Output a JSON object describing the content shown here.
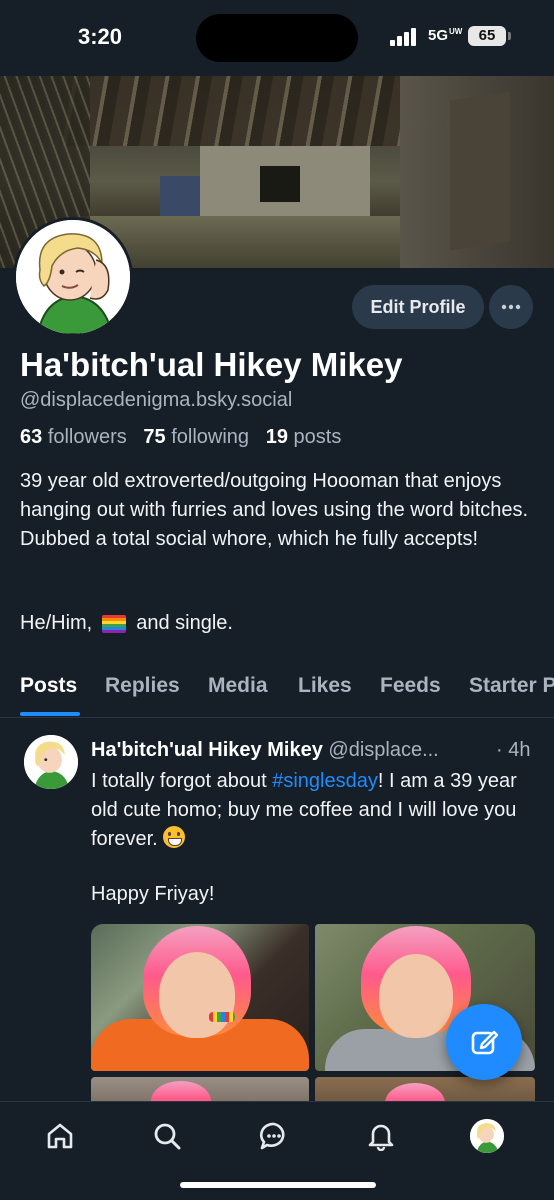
{
  "status_bar": {
    "time": "3:20",
    "network": "5G",
    "network_sub": "UW",
    "battery": "65"
  },
  "profile": {
    "display_name": "Ha'bitch'ual Hikey Mikey",
    "handle": "@displacedenigma.bsky.social",
    "followers_count": "63",
    "followers_label": "followers",
    "following_count": "75",
    "following_label": "following",
    "posts_count": "19",
    "posts_label": "posts",
    "bio": "39 year old extroverted/outgoing Hoooman that enjoys hanging out with furries and loves using the word bitches. Dubbed a total social whore, which he fully accepts!",
    "pronouns_before": "He/Him,",
    "pronouns_after": "and single.",
    "edit_profile_label": "Edit Profile"
  },
  "tabs": [
    {
      "label": "Posts",
      "active": true
    },
    {
      "label": "Replies",
      "active": false
    },
    {
      "label": "Media",
      "active": false
    },
    {
      "label": "Likes",
      "active": false
    },
    {
      "label": "Feeds",
      "active": false
    },
    {
      "label": "Starter P",
      "active": false
    }
  ],
  "post": {
    "author_name": "Ha'bitch'ual Hikey Mikey",
    "author_handle": "@displace...",
    "time": "· 4h",
    "text_before": "I totally forgot about ",
    "hashtag": "#singlesday",
    "text_after": "! I am a 39 year old cute homo; buy me coffee and I will love you forever.",
    "greeting": "Happy Friyay!",
    "photo_count": 4
  },
  "icons": {
    "home": "home-icon",
    "search": "search-icon",
    "chat": "chat-icon",
    "notifications": "bell-icon",
    "compose": "compose-icon"
  },
  "colors": {
    "background": "#161e27",
    "accent": "#208bfe",
    "secondary_text": "#a9b4c0",
    "button_bg": "#2b3a4a"
  }
}
